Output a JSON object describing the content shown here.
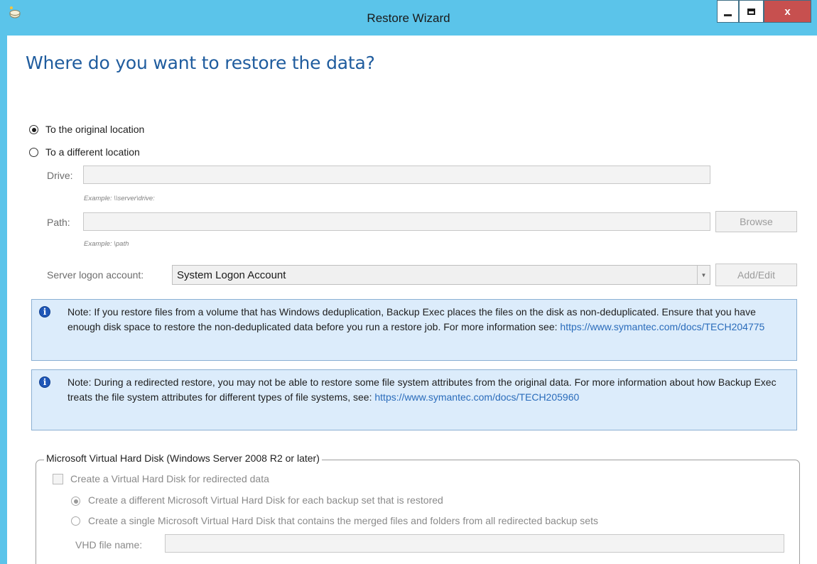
{
  "window": {
    "title": "Restore Wizard",
    "app_icon": "restore-wizard-icon",
    "minimize_icon": "minimize-icon",
    "maximize_icon": "maximize-icon",
    "close_glyph": "x"
  },
  "page": {
    "heading": "Where do you want to restore the data?"
  },
  "restore_target": {
    "original_label": "To the original location",
    "original_checked": true,
    "different_label": "To a different location",
    "different_checked": false
  },
  "drive": {
    "label": "Drive:",
    "value": "",
    "example": "Example: \\\\server\\drive:"
  },
  "path": {
    "label": "Path:",
    "value": "",
    "example": "Example: \\path",
    "browse_label": "Browse"
  },
  "logon": {
    "label": "Server logon account:",
    "selected": "System Logon Account",
    "add_edit_label": "Add/Edit"
  },
  "notes": [
    {
      "text": "Note: If you restore files from a volume that has Windows deduplication, Backup Exec places the files on the disk as non-deduplicated. Ensure that you have enough disk space to restore the non-deduplicated data before you run a restore job. For more information see: ",
      "link": "https://www.symantec.com/docs/TECH204775"
    },
    {
      "text": "Note: During a redirected restore, you may not be able to restore some file system attributes from the original data. For more information about how Backup Exec treats the file system attributes for different types of file systems, see: ",
      "link": "https://www.symantec.com/docs/TECH205960"
    }
  ],
  "vhd": {
    "group_title": "Microsoft Virtual Hard Disk (Windows Server 2008 R2 or later)",
    "create_label": "Create a Virtual Hard Disk for redirected data",
    "create_checked": false,
    "option_each_label": "Create a different Microsoft Virtual Hard Disk for each backup set that is restored",
    "option_each_checked": true,
    "option_single_label": "Create a single Microsoft Virtual Hard Disk that contains the merged files and folders from all redirected backup sets",
    "option_single_checked": false,
    "file_name_label": "VHD file name:",
    "file_name_value": ""
  },
  "colors": {
    "titlebar": "#5bc4ea",
    "heading": "#1f5c9e",
    "note_background": "#dcecfb",
    "note_border": "#8bb0d3",
    "link": "#2a6cbb",
    "close_button": "#c7504f"
  }
}
